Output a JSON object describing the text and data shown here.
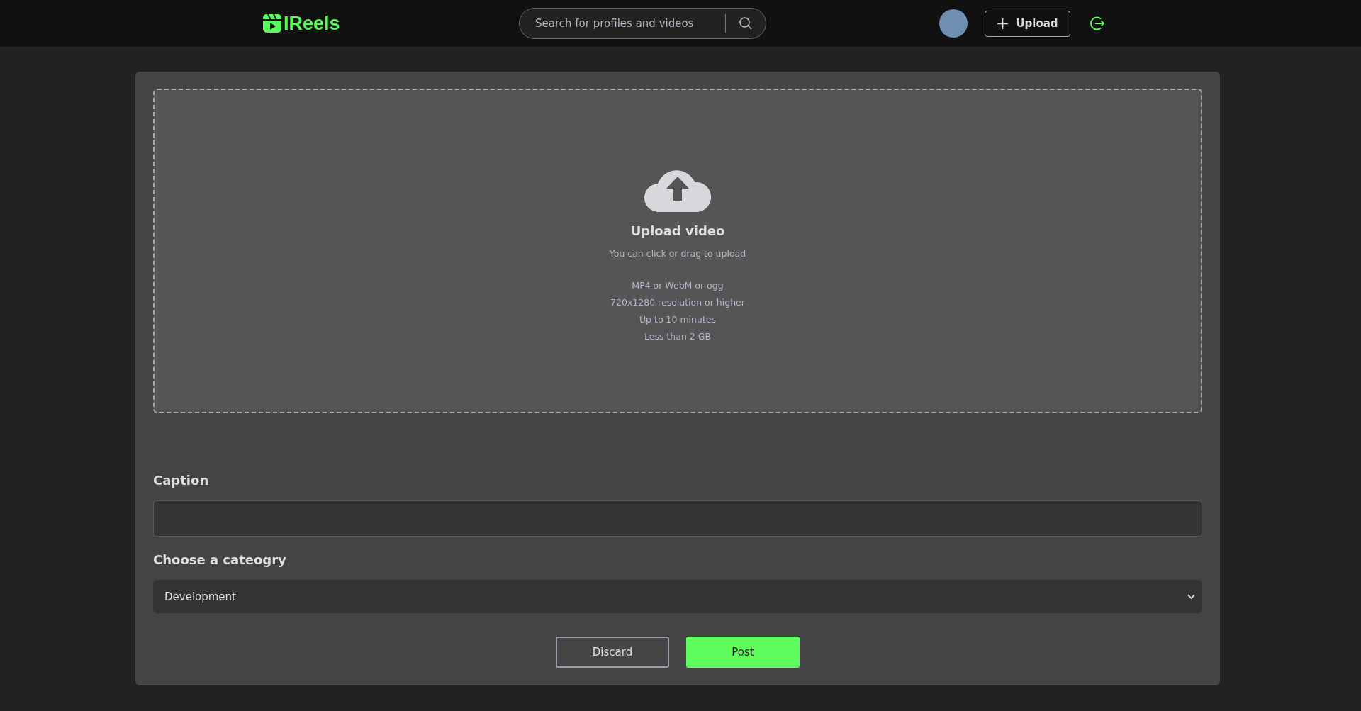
{
  "header": {
    "logo": "IReels",
    "search": {
      "placeholder": "Search for profiles and videos"
    },
    "upload_button": "Upload"
  },
  "dropzone": {
    "title": "Upload video",
    "subtitle": "You can click or drag to upload",
    "requirements": [
      "MP4 or WebM or ogg",
      "720x1280 resolution or higher",
      "Up to 10 minutes",
      "Less than 2 GB"
    ]
  },
  "caption": {
    "label": "Caption"
  },
  "category": {
    "label": "Choose a cateogry",
    "value": "Development"
  },
  "buttons": [
    {
      "label": "Discard",
      "kind": "secondary"
    },
    {
      "label": "Post",
      "kind": "primary"
    }
  ]
}
